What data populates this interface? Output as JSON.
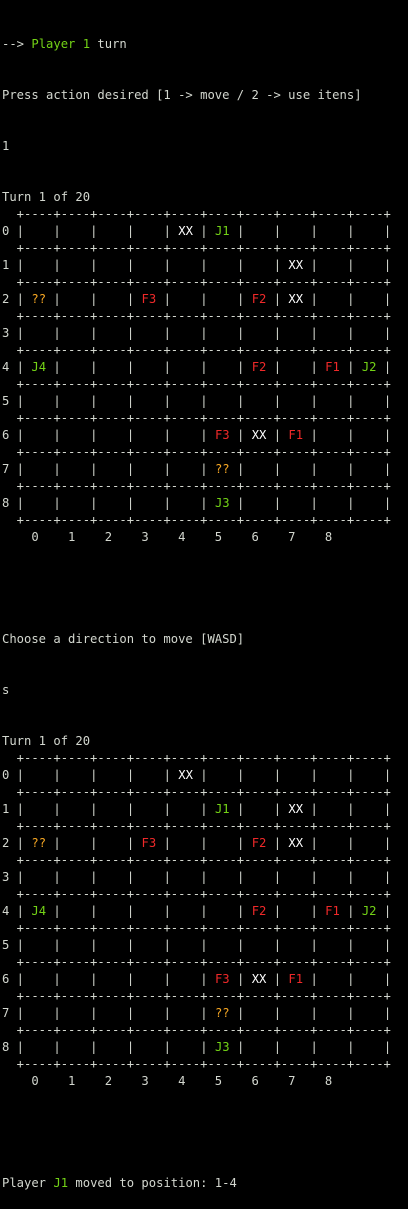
{
  "colors": {
    "background": "#000000",
    "text": "#d3d7cf",
    "player": "#73d216",
    "enemy": "#ef2929",
    "unknown": "#f5a623",
    "wall": "#ffffff"
  },
  "header": {
    "arrow": "--> ",
    "player_label": "Player 1",
    "turn_word": " turn",
    "prompt_action": "Press action desired [1 -> move / 2 -> use itens]",
    "action_input": "1"
  },
  "boards": [
    {
      "turn_label": "Turn 1 of 20",
      "rows": [
        [
          "",
          "",
          "",
          "",
          "XX",
          "J1",
          "",
          "",
          "",
          ""
        ],
        [
          "",
          "",
          "",
          "",
          "",
          "",
          "",
          "XX",
          "",
          ""
        ],
        [
          "??",
          "",
          "",
          "F3",
          "",
          "",
          "F2",
          "XX",
          "",
          ""
        ],
        [
          "",
          "",
          "",
          "",
          "",
          "",
          "",
          "",
          "",
          ""
        ],
        [
          "J4",
          "",
          "",
          "",
          "",
          "",
          "F2",
          "",
          "F1",
          "J2"
        ],
        [
          "",
          "",
          "",
          "",
          "",
          "",
          "",
          "",
          "",
          ""
        ],
        [
          "",
          "",
          "",
          "",
          "",
          "F3",
          "XX",
          "F1",
          "",
          ""
        ],
        [
          "",
          "",
          "",
          "",
          "",
          "??",
          "",
          "",
          "",
          ""
        ],
        [
          "",
          "",
          "",
          "",
          "",
          "J3",
          "",
          "",
          "",
          ""
        ]
      ]
    },
    {
      "turn_label": "Turn 1 of 20",
      "rows": [
        [
          "",
          "",
          "",
          "",
          "XX",
          "",
          "",
          "",
          "",
          ""
        ],
        [
          "",
          "",
          "",
          "",
          "",
          "J1",
          "",
          "XX",
          "",
          ""
        ],
        [
          "??",
          "",
          "",
          "F3",
          "",
          "",
          "F2",
          "XX",
          "",
          ""
        ],
        [
          "",
          "",
          "",
          "",
          "",
          "",
          "",
          "",
          "",
          ""
        ],
        [
          "J4",
          "",
          "",
          "",
          "",
          "",
          "F2",
          "",
          "F1",
          "J2"
        ],
        [
          "",
          "",
          "",
          "",
          "",
          "",
          "",
          "",
          "",
          ""
        ],
        [
          "",
          "",
          "",
          "",
          "",
          "F3",
          "XX",
          "F1",
          "",
          ""
        ],
        [
          "",
          "",
          "",
          "",
          "",
          "??",
          "",
          "",
          "",
          ""
        ],
        [
          "",
          "",
          "",
          "",
          "",
          "J3",
          "",
          "",
          "",
          ""
        ]
      ]
    }
  ],
  "row_labels": [
    "0",
    "1",
    "2",
    "3",
    "4",
    "5",
    "6",
    "7",
    "8"
  ],
  "col_labels": [
    "0",
    "1",
    "2",
    "3",
    "4",
    "5",
    "6",
    "7",
    "8"
  ],
  "prompt_direction": "Choose a direction to move [WASD]",
  "direction_input": "s",
  "result": {
    "prefix": "Player ",
    "player": "J1",
    "suffix": " moved to position: 1-4"
  }
}
